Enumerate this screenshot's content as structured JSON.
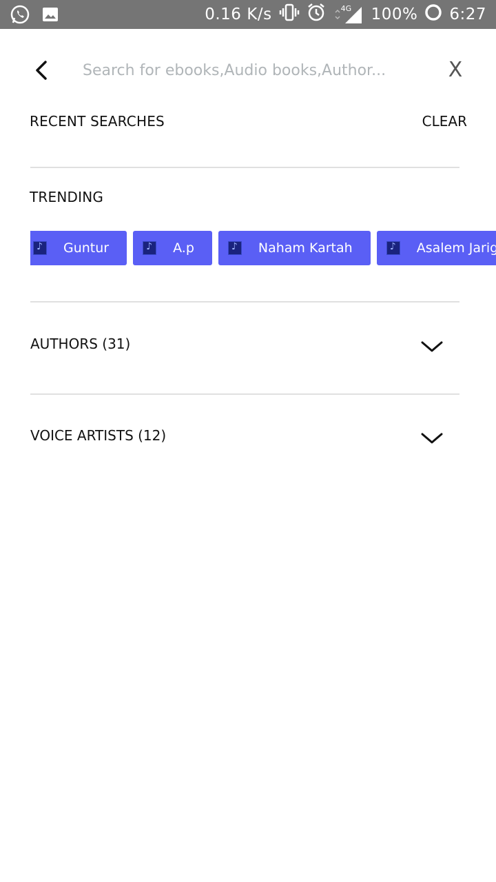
{
  "status_bar": {
    "net_speed": "0.16 K/s",
    "network": "4G",
    "battery": "100%",
    "time": "6:27",
    "icons": [
      "whatsapp-icon",
      "image-icon",
      "vibrate-icon",
      "alarm-icon",
      "signal-icon",
      "battery-icon"
    ]
  },
  "search": {
    "placeholder": "Search for ebooks,Audio books,Author...",
    "value": "",
    "close_label": "X"
  },
  "recent": {
    "title": "RECENT SEARCHES",
    "clear_label": "CLEAR"
  },
  "trending": {
    "title": "TRENDING",
    "chip_color": "#5a5ff5",
    "items": [
      {
        "label": "Guntur"
      },
      {
        "label": "A.p"
      },
      {
        "label": "Naham Kartah"
      },
      {
        "label": "Asalem Jarigin"
      }
    ]
  },
  "authors": {
    "label": "AUTHORS (31)"
  },
  "voice_artists": {
    "label": "VOICE ARTISTS (12)"
  }
}
